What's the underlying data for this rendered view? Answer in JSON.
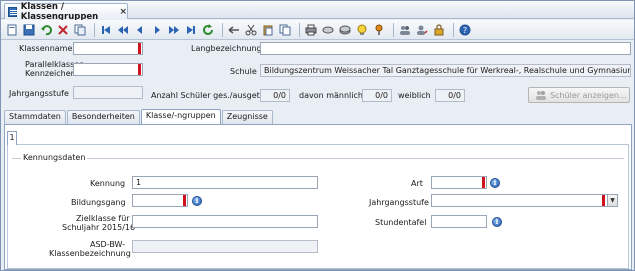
{
  "window": {
    "tab_title": "Klassen / Klassengruppen",
    "close": "×"
  },
  "toolbar": {
    "icons": [
      "new-doc-icon",
      "save-icon",
      "undo-icon",
      "delete-icon",
      "copy-icon",
      "first-icon",
      "prev-fast-icon",
      "prev-icon",
      "next-icon",
      "next-fast-icon",
      "last-icon",
      "refresh-icon",
      "arrow-left-icon",
      "cut-icon",
      "paste-icon",
      "copy2-icon",
      "print-icon",
      "preview-icon",
      "disk-icon",
      "lightbulb-icon",
      "pin-icon",
      "users-icon",
      "user-edit-icon",
      "lock-icon",
      "help-icon"
    ]
  },
  "header": {
    "klassenname_label": "Klassenname",
    "klassenname_value": "",
    "langbezeichnung_label": "Langbezeichnung",
    "langbezeichnung_value": "",
    "parallelklassen_label_1": "Parallelklassen",
    "parallelklassen_label_2": "Kennzeichen",
    "parallelklassen_value": "",
    "schule_label": "Schule",
    "schule_value": "Bildungszentrum Weissacher Tal Ganztagesschule für Werkreal-, Realschule und Gymnasium",
    "jahrgangsstufe_label": "Jahrgangsstufe",
    "jahrgangsstufe_value": "",
    "anzahl_label": "Anzahl Schüler ges./ausgetr.",
    "anzahl_value": "0/0",
    "maennlich_label": "davon männlich",
    "maennlich_value": "0/0",
    "weiblich_label": "weiblich",
    "weiblich_value": "0/0",
    "schueler_button": "Schüler anzeigen..."
  },
  "tabs": [
    "Stammdaten",
    "Besonderheiten",
    "Klasse/-ngruppen",
    "Zeugnisse"
  ],
  "active_tab": "Klasse/-ngruppen",
  "subtab": "1",
  "kennungsdaten": {
    "group_title": "Kennungsdaten",
    "kennung_label": "Kennung",
    "kennung_value": "1",
    "art_label": "Art",
    "art_value": "",
    "bildungsgang_label": "Bildungsgang",
    "bildungsgang_value": "",
    "jahrgangsstufe_label": "Jahrgangsstufe",
    "jahrgangsstufe_value": "",
    "zielklasse_label_1": "Zielklasse für",
    "zielklasse_label_2": "Schuljahr 2015/16",
    "zielklasse_value": "",
    "stundentafel_label": "Stundentafel",
    "stundentafel_value": "",
    "asd_label_1": "ASD-BW-",
    "asd_label_2": "Klassenbezeichnung",
    "asd_value": ""
  },
  "colors": {
    "required": "#d0101c",
    "info": "#2a64b3"
  }
}
